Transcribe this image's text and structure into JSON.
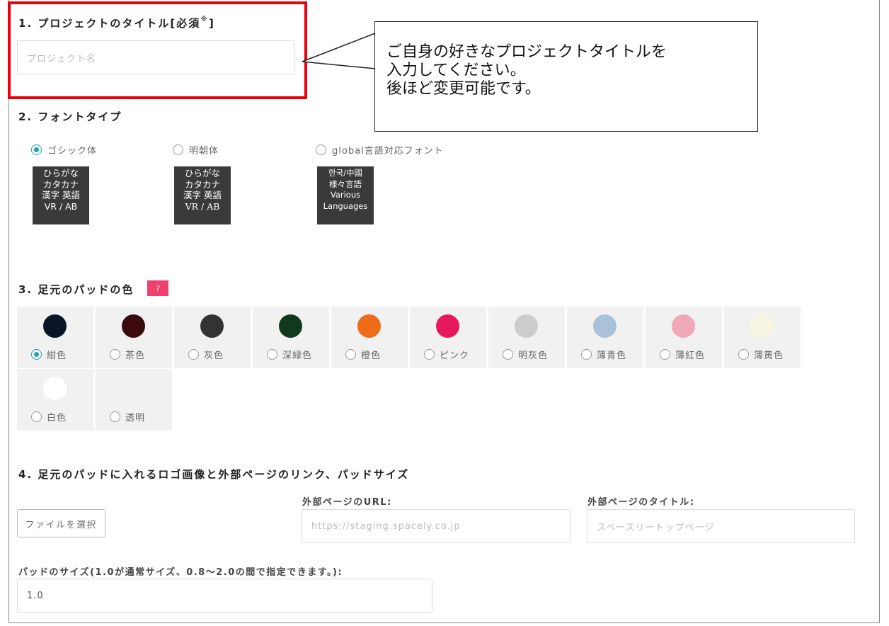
{
  "section1": {
    "title": "1. プロジェクトのタイトル[必須",
    "required_mark": "※",
    "title_end": "]",
    "input_placeholder": "プロジェクト名"
  },
  "callout": {
    "lines": [
      "ご自身の好きなプロジェクトタイトルを",
      "入力してください。",
      "後ほど変更可能です。"
    ]
  },
  "section2": {
    "title": "2. フォントタイプ",
    "options": [
      {
        "label": "ゴシック体",
        "selected": true,
        "preview": [
          "ひらがな",
          "カタカナ",
          "漢字 英語",
          "VR / AB"
        ]
      },
      {
        "label": "明朝体",
        "selected": false,
        "preview": [
          "ひらがな",
          "カタカナ",
          "漢字 英語",
          "VR / AB"
        ]
      },
      {
        "label": "global言語対応フォント",
        "selected": false,
        "preview": [
          "한국/中國",
          "様々言語",
          "Various",
          "Languages"
        ]
      }
    ]
  },
  "section3": {
    "title": "3. 足元のパッドの色",
    "help_badge": "?",
    "colors": [
      {
        "label": "紺色",
        "hex": "#0a1628",
        "selected": true
      },
      {
        "label": "茶色",
        "hex": "#3a0a0e",
        "selected": false
      },
      {
        "label": "灰色",
        "hex": "#333333",
        "selected": false
      },
      {
        "label": "深緑色",
        "hex": "#0f3a1e",
        "selected": false
      },
      {
        "label": "橙色",
        "hex": "#ee6b1a",
        "selected": false
      },
      {
        "label": "ピンク",
        "hex": "#e8185e",
        "selected": false
      },
      {
        "label": "明灰色",
        "hex": "#cccccc",
        "selected": false
      },
      {
        "label": "薄青色",
        "hex": "#a9c2da",
        "selected": false
      },
      {
        "label": "薄紅色",
        "hex": "#f0a8b8",
        "selected": false
      },
      {
        "label": "薄黄色",
        "hex": "#f7f4df",
        "selected": false
      },
      {
        "label": "白色",
        "hex": "#ffffff",
        "selected": false
      },
      {
        "label": "透明",
        "hex": "",
        "selected": false
      }
    ]
  },
  "section4": {
    "title": "4. 足元のパッドに入れるロゴ画像と外部ページのリンク、パッドサイズ",
    "file_button": "ファイルを選択",
    "url_label": "外部ページのURL:",
    "url_placeholder": "https://staging.spacely.co.jp",
    "page_title_label": "外部ページのタイトル:",
    "page_title_placeholder": "スペースリートップページ",
    "size_label": "パッドのサイズ(1.0が通常サイズ、0.8〜2.0の間で指定できます。):",
    "size_value": "1.0"
  },
  "colors": {
    "accent": "#1aa3a8",
    "highlight": "#e8000b",
    "badge": "#ef3f6c"
  }
}
